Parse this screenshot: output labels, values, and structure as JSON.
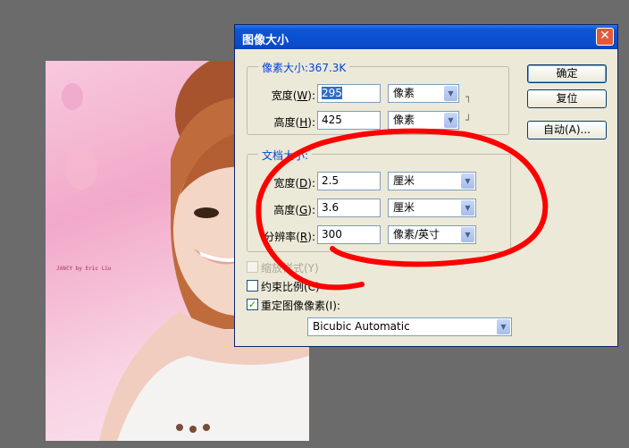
{
  "photo": {
    "credit_text": "JANCY by Eric Liu"
  },
  "dialog": {
    "title": "图像大小",
    "close_glyph": "✕",
    "pixel_dimensions": {
      "legend": "像素大小:367.3K",
      "width": {
        "label": "宽度(",
        "key": "W",
        "label_end": "):",
        "value": "295",
        "unit": "像素"
      },
      "height": {
        "label": "高度(",
        "key": "H",
        "label_end": "):",
        "value": "425",
        "unit": "像素"
      }
    },
    "document_size": {
      "legend": "文档大小:",
      "width": {
        "label": "宽度(",
        "key": "D",
        "label_end": "):",
        "value": "2.5",
        "unit": "厘米"
      },
      "height": {
        "label": "高度(",
        "key": "G",
        "label_end": "):",
        "value": "3.6",
        "unit": "厘米"
      },
      "resolution": {
        "label": "分辨率(",
        "key": "R",
        "label_end": "):",
        "value": "300",
        "unit": "像素/英寸"
      }
    },
    "buttons": {
      "ok": "确定",
      "reset": "复位",
      "auto": "自动(A)..."
    },
    "options": {
      "scale_styles": {
        "label": "缩放样式(Y)",
        "checked": false,
        "enabled": false
      },
      "constrain": {
        "label": "约束比例(C)",
        "checked": false,
        "enabled": true
      },
      "resample": {
        "label": "重定图像像素(I):",
        "checked": true,
        "enabled": true,
        "check_glyph": "✓"
      }
    },
    "resample_method": "Bicubic Automatic"
  },
  "annotation": {
    "color": "#ff0000"
  }
}
